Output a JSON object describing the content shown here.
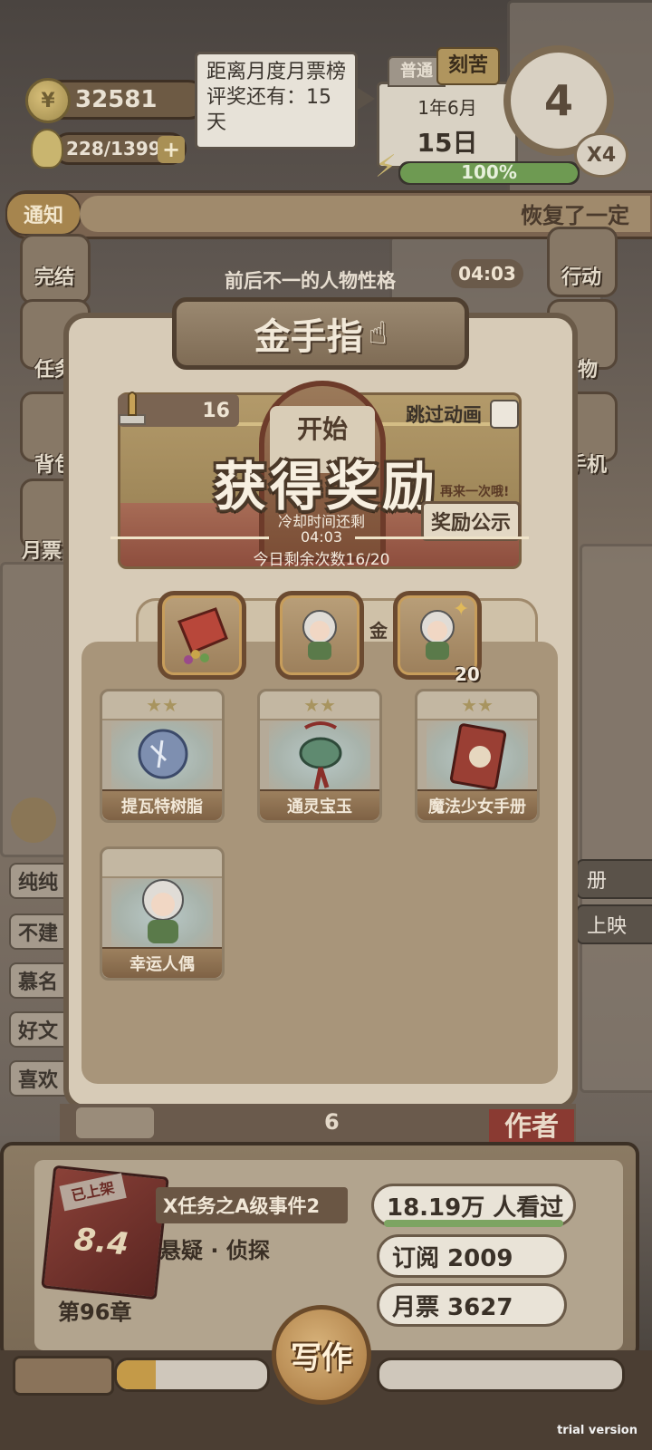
{
  "hud": {
    "coins": "32581",
    "energy": "228/1399",
    "bubble_text": "距离月度月票榜评奖还有：15天",
    "calendar_tab_normal": "普通",
    "calendar_tab_hard": "刻苦",
    "calendar_month": "1年6月",
    "calendar_day": "15日",
    "energy_percent": "100%",
    "clock_number": "4",
    "speed": "X4"
  },
  "notice": {
    "tag": "通知",
    "text": "恢复了一定"
  },
  "side_left": [
    "完结",
    "任务",
    "背包",
    "月票"
  ],
  "side_right": [
    "行动",
    "物",
    "手机"
  ],
  "center_label": "前后不一的人物性格",
  "timer_top": "04:03",
  "left_tags": [
    "纯纯",
    "不建",
    "慕名",
    "好文",
    "喜欢"
  ],
  "right_tags": [
    "册",
    "上映"
  ],
  "dialog": {
    "title": "金手指",
    "counter": "16",
    "skip_label": "跳过动画",
    "start_label": "开始",
    "reward_title": "获得奖励",
    "again_text": "再来一次哦!",
    "public_button": "奖励公示",
    "cooldown_label": "冷却时间还剩",
    "cooldown_time": "04:03",
    "remaining": "今日剩余次数16/20",
    "tab_partial": "金",
    "prizes": [
      {
        "icon": "candy-bag-icon",
        "count": ""
      },
      {
        "icon": "doll-icon",
        "count": ""
      },
      {
        "icon": "doll-icon",
        "count": "20"
      }
    ],
    "cards": [
      {
        "name": "提瓦特树脂",
        "stars": "★★",
        "icon": "resin-orb-icon"
      },
      {
        "name": "通灵宝玉",
        "stars": "★★",
        "icon": "jade-pendant-icon"
      },
      {
        "name": "魔法少女手册",
        "stars": "★★",
        "icon": "magic-book-icon"
      },
      {
        "name": "幸运人偶",
        "stars": "",
        "icon": "lucky-doll-icon"
      }
    ]
  },
  "bottom_page": "6",
  "book": {
    "badge": "已上架",
    "score": "8.4",
    "title": "X任务之A级事件2",
    "genre": "悬疑 · 侦探",
    "chapter": "第96章",
    "views": "18.19万  人看过",
    "subscribe": "订阅  2009",
    "votes": "月票  3627"
  },
  "write_button": "写作",
  "bottom_labels": [
    "作者"
  ],
  "watermark": "trial version",
  "colors": {
    "dialog_bg": "#d7cbb7",
    "accent_brown": "#6a5a48",
    "banner_gold": "#b39a6a"
  }
}
